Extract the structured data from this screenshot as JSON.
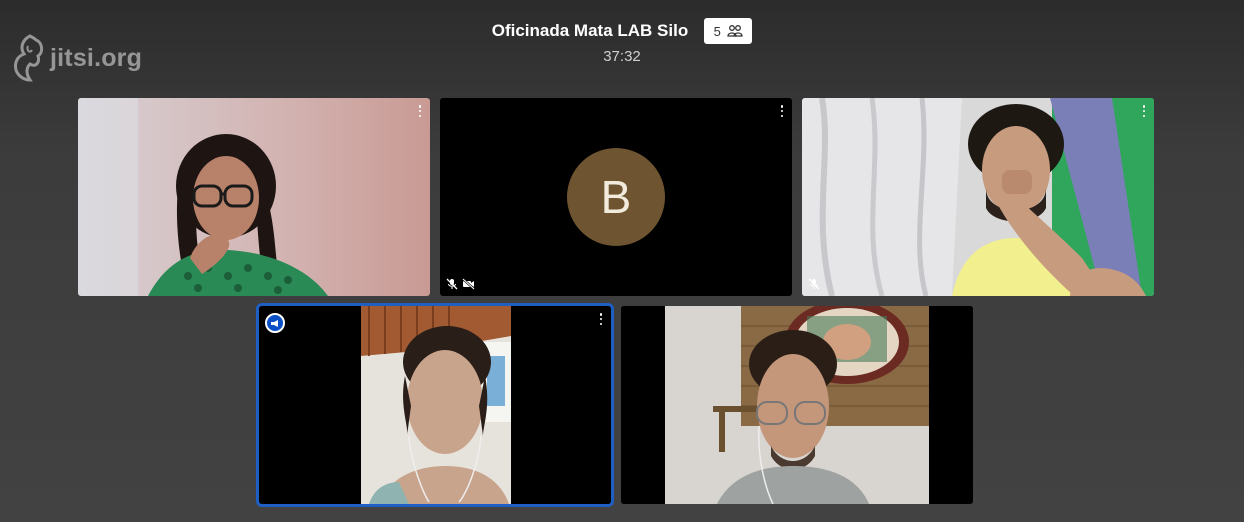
{
  "brand": {
    "logo_text": "jitsi.org",
    "logo_icon": "jitsi-logo-icon"
  },
  "meeting": {
    "title": "Oficinada Mata LAB Silo",
    "participant_count": "5",
    "participants_icon": "participants-icon",
    "elapsed_time": "37:32"
  },
  "tiles": [
    {
      "id": "participant-1",
      "video": "on",
      "muted": false
    },
    {
      "id": "participant-b",
      "video": "off",
      "avatar_letter": "B",
      "avatar_color": "#6e5430",
      "muted": true,
      "camera_off": true
    },
    {
      "id": "participant-3",
      "video": "on",
      "muted": true
    },
    {
      "id": "participant-4",
      "video": "on",
      "dominant_speaker": true,
      "highlight_color": "#1d5fc2"
    },
    {
      "id": "participant-5",
      "video": "on",
      "muted": false
    }
  ],
  "icons": {
    "menu": "more-vertical-icon",
    "mic_muted": "mic-muted-icon",
    "camera_off": "camera-off-icon",
    "dominant": "dominant-speaker-icon"
  }
}
